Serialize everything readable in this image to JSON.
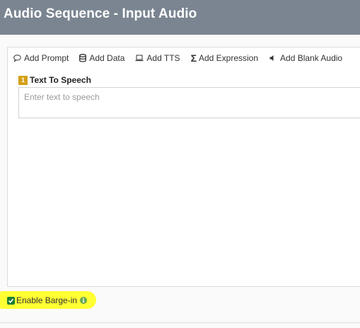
{
  "header": {
    "title": "Audio Sequence - Input Audio"
  },
  "toolbar": {
    "items": [
      {
        "label": "Add Prompt",
        "icon": "comment-icon"
      },
      {
        "label": "Add Data",
        "icon": "database-icon"
      },
      {
        "label": "Add TTS",
        "icon": "laptop-icon"
      },
      {
        "label": "Add Expression",
        "icon": "sigma-icon"
      },
      {
        "label": "Add Blank Audio",
        "icon": "volume-off-icon"
      }
    ]
  },
  "tts_block": {
    "index": "1",
    "title": "Text To Speech",
    "placeholder": "Enter text to speech",
    "value": ""
  },
  "barge_in": {
    "label": "Enable Barge-in",
    "checked": true
  },
  "colors": {
    "header_bg": "#7a8591",
    "badge": "#d4a017",
    "checkbox": "#1e7e34",
    "highlight": "#ffff33",
    "info": "#6aa84f"
  }
}
